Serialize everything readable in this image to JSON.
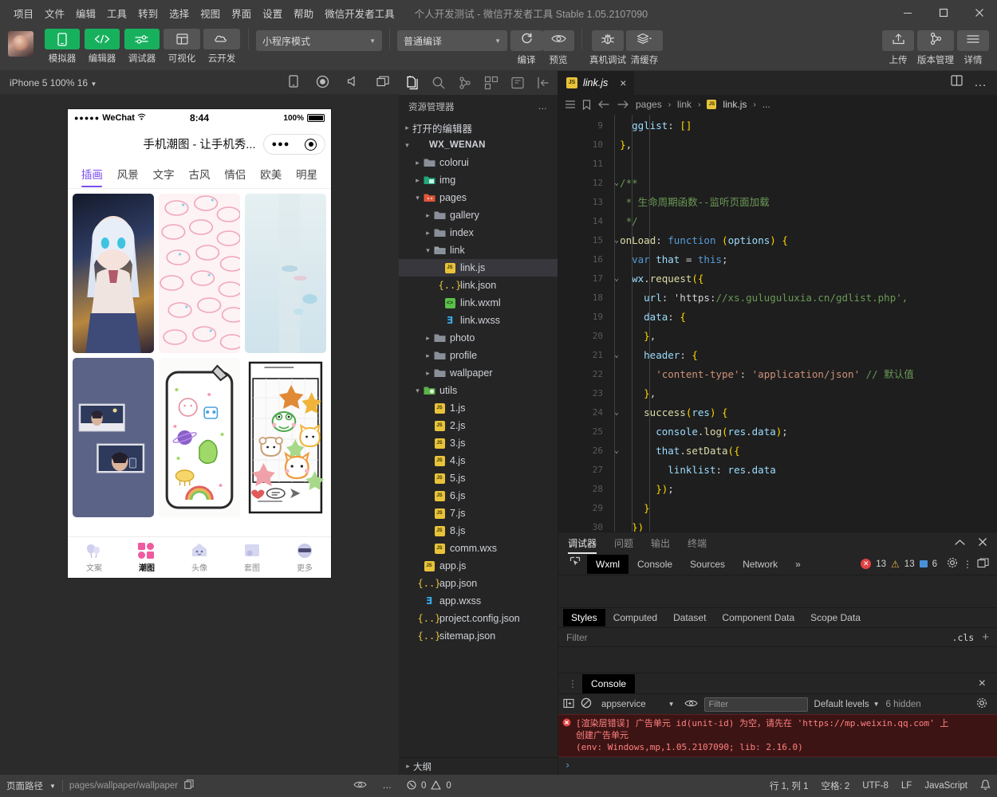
{
  "menubar": {
    "items": [
      "项目",
      "文件",
      "编辑",
      "工具",
      "转到",
      "选择",
      "视图",
      "界面",
      "设置",
      "帮助",
      "微信开发者工具"
    ],
    "window_title": "个人开发测试 - 微信开发者工具 Stable 1.05.2107090",
    "minimize": "minimize-icon",
    "maximize": "maximize-icon",
    "close": "close-icon"
  },
  "toolbar": {
    "tools": [
      {
        "label": "模拟器",
        "icon": "phone-icon",
        "active": true
      },
      {
        "label": "编辑器",
        "icon": "code-icon",
        "active": true
      },
      {
        "label": "调试器",
        "icon": "sliders-icon",
        "active": true
      },
      {
        "label": "可视化",
        "icon": "layout-icon",
        "active": false
      },
      {
        "label": "云开发",
        "icon": "cloud-icon",
        "active": false
      }
    ],
    "mode_select": "小程序模式",
    "compile_select": "普通编译",
    "actions": [
      {
        "label": "编译",
        "icon": "refresh-icon"
      },
      {
        "label": "预览",
        "icon": "eye-icon"
      },
      {
        "label": "真机调试",
        "icon": "bug-icon"
      },
      {
        "label": "清缓存",
        "icon": "layers-icon"
      }
    ],
    "right_actions": [
      {
        "label": "上传",
        "icon": "upload-icon"
      },
      {
        "label": "版本管理",
        "icon": "git-branch-icon"
      },
      {
        "label": "详情",
        "icon": "menu-icon"
      }
    ]
  },
  "simulator": {
    "device_label": "iPhone 5 100% 16",
    "icons": [
      "phone-rotate-icon",
      "record-icon",
      "volume-icon",
      "window-icon"
    ],
    "phone": {
      "status": {
        "carrier": "WeChat",
        "dots": "●●●●●",
        "time": "8:44",
        "battery_pct": "100%"
      },
      "nav_title": "手机潮图 - 让手机秀...",
      "tabs": [
        "插画",
        "风景",
        "文字",
        "古风",
        "情侣",
        "欧美",
        "明星"
      ],
      "active_tab": "插画",
      "tabbar": [
        {
          "label": "文案",
          "icon": "balloons-icon",
          "active": false
        },
        {
          "label": "潮图",
          "icon": "grid-icon",
          "active": true
        },
        {
          "label": "头像",
          "icon": "ghost-icon",
          "active": false
        },
        {
          "label": "套图",
          "icon": "album-icon",
          "active": false
        },
        {
          "label": "更多",
          "icon": "sunglasses-icon",
          "active": false
        }
      ]
    }
  },
  "explorer": {
    "activity_icons": [
      "files-icon",
      "search-icon",
      "source-control-icon",
      "extensions-icon",
      "debug-icon",
      "collapse-icon"
    ],
    "title": "资源管理器",
    "more": "…",
    "sections": [
      {
        "label": "打开的编辑器",
        "indent": 0,
        "arrow": "▸",
        "kind": "section"
      },
      {
        "label": "WX_WENAN",
        "indent": 0,
        "arrow": "▾",
        "kind": "root"
      },
      {
        "label": "colorui",
        "indent": 1,
        "arrow": "▸",
        "kind": "folder"
      },
      {
        "label": "img",
        "indent": 1,
        "arrow": "▸",
        "kind": "folder-img"
      },
      {
        "label": "pages",
        "indent": 1,
        "arrow": "▾",
        "kind": "folder-pages"
      },
      {
        "label": "gallery",
        "indent": 2,
        "arrow": "▸",
        "kind": "folder"
      },
      {
        "label": "index",
        "indent": 2,
        "arrow": "▸",
        "kind": "folder"
      },
      {
        "label": "link",
        "indent": 2,
        "arrow": "▾",
        "kind": "folder-open"
      },
      {
        "label": "link.js",
        "indent": 3,
        "arrow": "",
        "kind": "js",
        "selected": true
      },
      {
        "label": "link.json",
        "indent": 3,
        "arrow": "",
        "kind": "json"
      },
      {
        "label": "link.wxml",
        "indent": 3,
        "arrow": "",
        "kind": "wxml"
      },
      {
        "label": "link.wxss",
        "indent": 3,
        "arrow": "",
        "kind": "wxss"
      },
      {
        "label": "photo",
        "indent": 2,
        "arrow": "▸",
        "kind": "folder"
      },
      {
        "label": "profile",
        "indent": 2,
        "arrow": "▸",
        "kind": "folder"
      },
      {
        "label": "wallpaper",
        "indent": 2,
        "arrow": "▸",
        "kind": "folder"
      },
      {
        "label": "utils",
        "indent": 1,
        "arrow": "▾",
        "kind": "folder-utils"
      },
      {
        "label": "1.js",
        "indent": 2,
        "arrow": "",
        "kind": "js"
      },
      {
        "label": "2.js",
        "indent": 2,
        "arrow": "",
        "kind": "js"
      },
      {
        "label": "3.js",
        "indent": 2,
        "arrow": "",
        "kind": "js"
      },
      {
        "label": "4.js",
        "indent": 2,
        "arrow": "",
        "kind": "js"
      },
      {
        "label": "5.js",
        "indent": 2,
        "arrow": "",
        "kind": "js"
      },
      {
        "label": "6.js",
        "indent": 2,
        "arrow": "",
        "kind": "js"
      },
      {
        "label": "7.js",
        "indent": 2,
        "arrow": "",
        "kind": "js"
      },
      {
        "label": "8.js",
        "indent": 2,
        "arrow": "",
        "kind": "js"
      },
      {
        "label": "comm.wxs",
        "indent": 2,
        "arrow": "",
        "kind": "js"
      },
      {
        "label": "app.js",
        "indent": 1,
        "arrow": "",
        "kind": "js"
      },
      {
        "label": "app.json",
        "indent": 1,
        "arrow": "",
        "kind": "json"
      },
      {
        "label": "app.wxss",
        "indent": 1,
        "arrow": "",
        "kind": "wxss"
      },
      {
        "label": "project.config.json",
        "indent": 1,
        "arrow": "",
        "kind": "json"
      },
      {
        "label": "sitemap.json",
        "indent": 1,
        "arrow": "",
        "kind": "json"
      }
    ],
    "outline_label": "大纲"
  },
  "editor": {
    "tab": {
      "name": "link.js",
      "icon": "js-icon",
      "close": "×"
    },
    "split_icon": "split-editor-icon",
    "more_icon": "more-icon",
    "breadcrumb": [
      "pages",
      "link",
      "link.js",
      "..."
    ],
    "breadcrumb_icons": [
      "list-icon",
      "bookmark-icon",
      "back-arrow-icon",
      "forward-arrow-icon"
    ],
    "lines": [
      {
        "n": "9",
        "fold": "",
        "text": "    gglist: []"
      },
      {
        "n": "10",
        "fold": "",
        "text": "  },"
      },
      {
        "n": "11",
        "fold": "",
        "text": ""
      },
      {
        "n": "12",
        "fold": "v",
        "text": "  /**"
      },
      {
        "n": "13",
        "fold": "",
        "text": "   * 生命周期函数--监听页面加载"
      },
      {
        "n": "14",
        "fold": "",
        "text": "   */"
      },
      {
        "n": "15",
        "fold": "v",
        "text": "  onLoad: function (options) {"
      },
      {
        "n": "16",
        "fold": "",
        "text": "    var that = this;"
      },
      {
        "n": "17",
        "fold": "v",
        "text": "    wx.request({"
      },
      {
        "n": "18",
        "fold": "",
        "text": "      url: 'https://xs.guluguluxia.cn/gdlist.php',"
      },
      {
        "n": "19",
        "fold": "",
        "text": "      data: {"
      },
      {
        "n": "20",
        "fold": "",
        "text": "      },"
      },
      {
        "n": "21",
        "fold": "v",
        "text": "      header: {"
      },
      {
        "n": "22",
        "fold": "",
        "text": "        'content-type': 'application/json' // 默认值"
      },
      {
        "n": "23",
        "fold": "",
        "text": "      },"
      },
      {
        "n": "24",
        "fold": "v",
        "text": "      success(res) {"
      },
      {
        "n": "25",
        "fold": "",
        "text": "        console.log(res.data);"
      },
      {
        "n": "26",
        "fold": "v",
        "text": "        that.setData({"
      },
      {
        "n": "27",
        "fold": "",
        "text": "          linklist: res.data"
      },
      {
        "n": "28",
        "fold": "",
        "text": "        });"
      },
      {
        "n": "29",
        "fold": "",
        "text": "      }"
      },
      {
        "n": "30",
        "fold": "",
        "text": "    })"
      }
    ]
  },
  "debugger": {
    "panel_tabs": [
      "调试器",
      "问题",
      "输出",
      "终端"
    ],
    "panel_active": "调试器",
    "collapse_icon": "chevron-up-icon",
    "close_icon": "close-icon",
    "devtools_tabs": [
      "Wxml",
      "Console",
      "Sources",
      "Network"
    ],
    "devtools_active": "Wxml",
    "overflow": "»",
    "inspect_icon": "inspect-icon",
    "counts": {
      "errors": "13",
      "warnings": "13",
      "info": "6"
    },
    "gear_icon": "gear-icon",
    "kebab_icon": "kebab-icon",
    "dock_icon": "dock-icon",
    "style_tabs": [
      "Styles",
      "Computed",
      "Dataset",
      "Component Data",
      "Scope Data"
    ],
    "style_active": "Styles",
    "filter_placeholder": "Filter",
    "cls_label": ".cls",
    "plus": "+",
    "console": {
      "tab": "Console",
      "close": "×",
      "context": "appservice",
      "filter_placeholder": "Filter",
      "levels": "Default levels",
      "hidden": "6 hidden",
      "eye_icon": "eye-icon",
      "clear_icon": "clear-icon",
      "sidebar_icon": "sidebar-icon",
      "settings_icon": "gear-icon",
      "message_line1": "[渲染层错误] 广告单元 id(unit-id) 为空，请先在 'https://mp.weixin.qq.com' 上",
      "message_line1_link": "https://mp.weixin.qq.com",
      "message_line2": "创建广告单元",
      "message_line3": "(env: Windows,mp,1.05.2107090; lib: 2.16.0)",
      "prompt": "›"
    }
  },
  "statusbar": {
    "page_path_label": "页面路径",
    "page_path": "pages/wallpaper/wallpaper",
    "copy_icon": "copy-icon",
    "eye_icon": "eye-icon",
    "more_icon": "more-icon",
    "problems": {
      "errors": "0",
      "warnings": "0"
    },
    "cursor": "行 1, 列 1",
    "spaces": "空格: 2",
    "encoding": "UTF-8",
    "eol": "LF",
    "language": "JavaScript",
    "bell_icon": "bell-icon"
  },
  "colors": {
    "accent_green": "#17b15e",
    "purple": "#7b4df0",
    "error_red": "#e05252",
    "warn_yellow": "#e2b340"
  }
}
